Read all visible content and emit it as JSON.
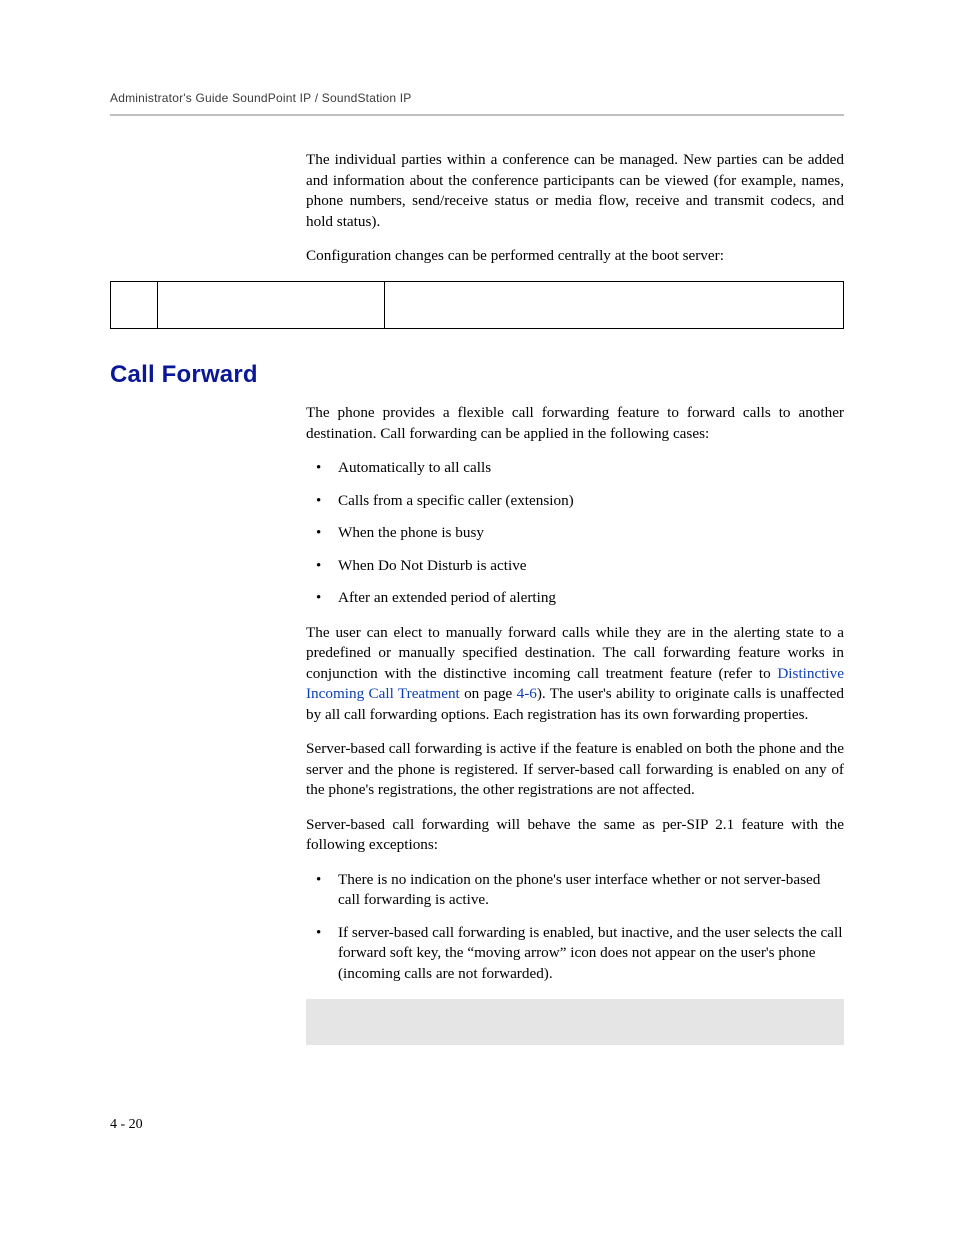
{
  "runningHead": "Administrator's Guide SoundPoint IP / SoundStation IP",
  "intro": {
    "p1": "The individual parties within a conference can be managed. New parties can be added and information about the conference participants can be viewed (for example, names, phone numbers, send/receive status or media flow, receive and transmit codecs, and hold status).",
    "p2": "Configuration changes can be performed centrally at the boot server:"
  },
  "sectionHeading": "Call Forward",
  "cf": {
    "p1": "The phone provides a flexible call forwarding feature to forward calls to another destination. Call forwarding can be applied in the following cases:",
    "bullets1": [
      "Automatically to all calls",
      "Calls from a specific caller (extension)",
      "When the phone is busy",
      "When Do Not Disturb is active",
      "After an extended period of alerting"
    ],
    "p2a": "The user can elect to manually forward calls while they are in the alerting state to a predefined or manually specified destination. The call forwarding feature works in conjunction with the distinctive incoming call treatment feature (refer to ",
    "linkText": "Distinctive Incoming Call Treatment",
    "p2b": " on page ",
    "linkPage": "4-6",
    "p2c": "). The user's ability to originate calls is unaffected by all call forwarding options. Each registration has its own forwarding properties.",
    "p3": "Server-based call forwarding is active if the feature is enabled on both the phone and the server and the phone is registered. If server-based call forwarding is enabled on any of the phone's registrations, the other registrations are not affected.",
    "p4": "Server-based call forwarding will behave the same as per-SIP 2.1 feature with the following exceptions:",
    "bullets2": [
      "There is no indication on the phone's user interface whether or not server-based call forwarding is active.",
      "If server-based call forwarding is enabled, but inactive, and the user selects the call forward soft key, the “moving arrow” icon does not appear on the user's phone (incoming calls are not forwarded)."
    ]
  },
  "pageNumber": "4 - 20"
}
